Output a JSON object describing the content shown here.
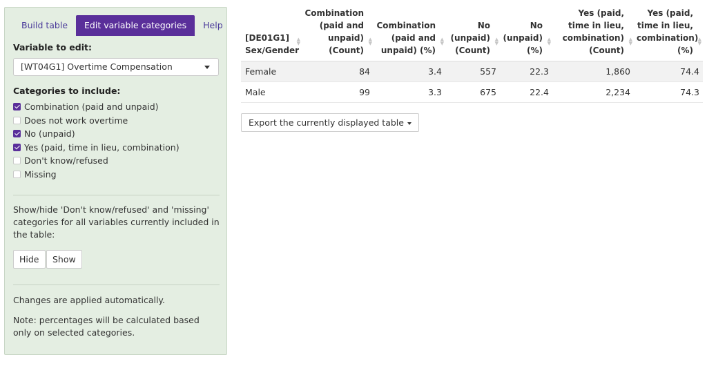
{
  "sidebar": {
    "tabs": [
      "Build table",
      "Edit variable categories",
      "Help"
    ],
    "active_tab": 1,
    "variable_label": "Variable to edit:",
    "variable_selected": "[WT04G1] Overtime Compensation",
    "categories_label": "Categories to include:",
    "categories": [
      {
        "label": "Combination (paid and unpaid)",
        "checked": true
      },
      {
        "label": "Does not work overtime",
        "checked": false
      },
      {
        "label": "No (unpaid)",
        "checked": true
      },
      {
        "label": "Yes (paid, time in lieu, combination)",
        "checked": true
      },
      {
        "label": "Don't know/refused",
        "checked": false
      },
      {
        "label": "Missing",
        "checked": false
      }
    ],
    "showhide_text": "Show/hide 'Don't know/refused' and 'missing' categories for all variables currently included in the table:",
    "hide_label": "Hide",
    "show_label": "Show",
    "changes_text": "Changes are applied automatically.",
    "note_text": "Note: percentages will be calculated based only on selected categories."
  },
  "table": {
    "headers": [
      "[DE01G1] Sex/Gender",
      "Combination (paid and unpaid) (Count)",
      "Combination (paid and unpaid) (%)",
      "No (unpaid) (Count)",
      "No (unpaid) (%)",
      "Yes (paid, time in lieu, combination) (Count)",
      "Yes (paid, time in lieu, combination) (%)"
    ],
    "rows": [
      [
        "Female",
        "84",
        "3.4",
        "557",
        "22.3",
        "1,860",
        "74.4"
      ],
      [
        "Male",
        "99",
        "3.3",
        "675",
        "22.4",
        "2,234",
        "74.3"
      ]
    ]
  },
  "export_label": "Export the currently displayed table",
  "colors": {
    "accent": "#5a2f9a",
    "sidebar_bg": "#e4eee2",
    "row_stripe": "#f2f2f2"
  }
}
